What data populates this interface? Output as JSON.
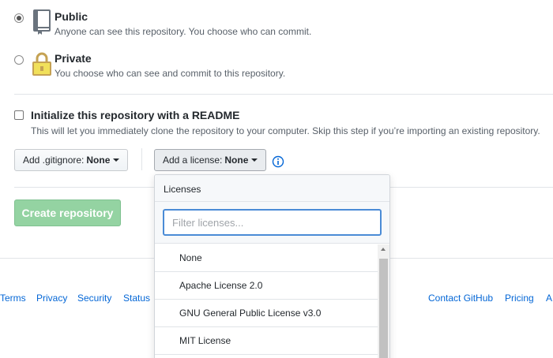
{
  "visibility": {
    "public": {
      "title": "Public",
      "description": "Anyone can see this repository. You choose who can commit.",
      "selected": true,
      "icon": "repo-icon"
    },
    "private": {
      "title": "Private",
      "description": "You choose who can see and commit to this repository.",
      "selected": false,
      "icon": "lock-icon"
    }
  },
  "readme": {
    "label": "Initialize this repository with a README",
    "description": "This will let you immediately clone the repository to your computer. Skip this step if you’re importing an existing repository.",
    "checked": false
  },
  "gitignore": {
    "label": "Add .gitignore:",
    "value": "None"
  },
  "license": {
    "label": "Add a license:",
    "value": "None"
  },
  "create_button": "Create repository",
  "license_dropdown": {
    "header": "Licenses",
    "filter_placeholder": "Filter licenses...",
    "items": [
      "None",
      "Apache License 2.0",
      "GNU General Public License v3.0",
      "MIT License"
    ]
  },
  "footer": {
    "left_links": [
      "Terms",
      "Privacy",
      "Security",
      "Status"
    ],
    "right_links": [
      "Contact GitHub",
      "Pricing",
      "A"
    ]
  },
  "colors": {
    "link": "#0366d6",
    "create_button_disabled": "#94d3a2",
    "focus_border": "#4a8bd6",
    "info_icon": "#0366d6"
  }
}
